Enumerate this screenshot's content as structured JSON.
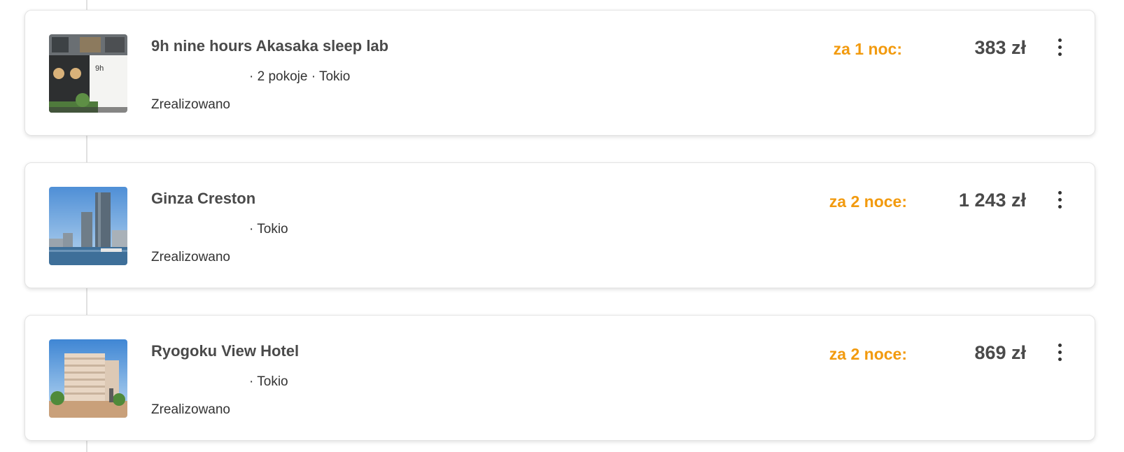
{
  "bookings": [
    {
      "name": "9h nine hours Akasaka sleep lab",
      "details": "· 2 pokoje · Tokio",
      "status": "Zrealizowano",
      "nights_label": "za 1 noc:",
      "price": "383 zł",
      "thumbnail": "capsule-hotel-facade-image",
      "sign_text": "9h"
    },
    {
      "name": "Ginza Creston",
      "details": "· Tokio",
      "status": "Zrealizowano",
      "nights_label": "za 2 noce:",
      "price": "1 243 zł",
      "thumbnail": "tokyo-skyline-image"
    },
    {
      "name": "Ryogoku View Hotel",
      "details": "· Tokio",
      "status": "Zrealizowano",
      "nights_label": "za 2 noce:",
      "price": "869 zł",
      "thumbnail": "hotel-building-image"
    }
  ],
  "colors": {
    "accent": "#f29a0e",
    "title": "#4a4a4a",
    "text": "#333333",
    "border": "#e3e3e3",
    "timeline": "#e1e1e1"
  },
  "icons": {
    "menu": "more-vertical-icon"
  }
}
